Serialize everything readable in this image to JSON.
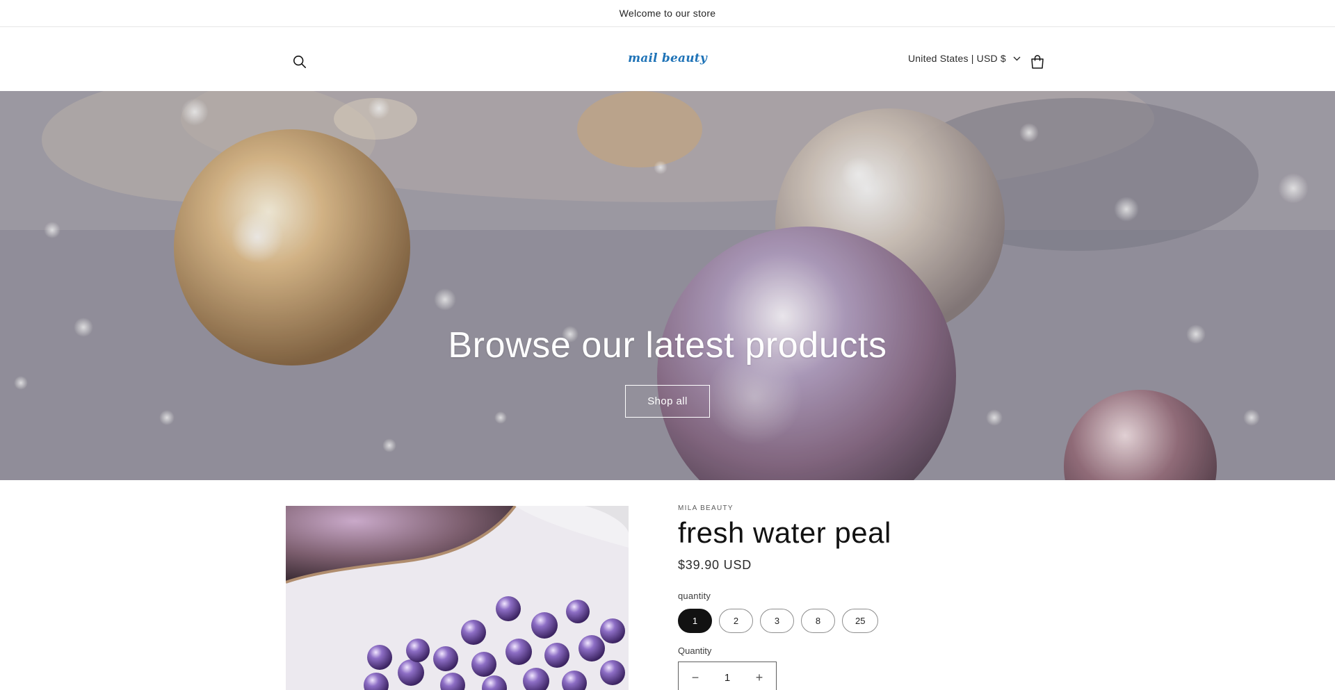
{
  "announcement": {
    "text": "Welcome to our store"
  },
  "header": {
    "logo_text": "mail beauty",
    "currency_label": "United States | USD $",
    "icons": {
      "search": "search-icon",
      "cart": "cart-icon",
      "chevron": "chevron-down-icon"
    }
  },
  "hero": {
    "title": "Browse our latest products",
    "button_label": "Shop all"
  },
  "product": {
    "vendor": "MILA BEAUTY",
    "title": "fresh water peal",
    "price": "$39.90 USD",
    "option_label": "quantity",
    "options": [
      "1",
      "2",
      "3",
      "8",
      "25"
    ],
    "selected_option": "1",
    "quantity_label": "Quantity",
    "quantity_value": "1",
    "minus_symbol": "−",
    "plus_symbol": "+"
  }
}
